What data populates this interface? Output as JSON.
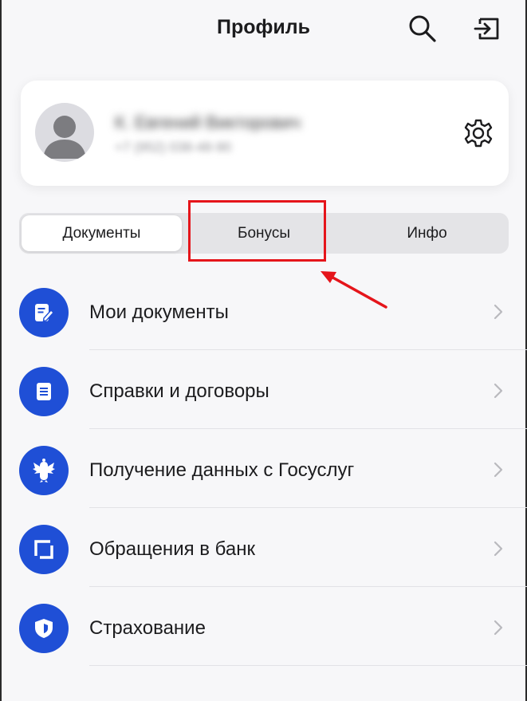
{
  "header": {
    "title": "Профиль",
    "search_icon": "search-icon",
    "logout_icon": "logout-icon"
  },
  "profile": {
    "name": "К. Евгений Викторович",
    "phone": "+7 (952) 038-48-90",
    "avatar_icon": "user-avatar-icon",
    "settings_icon": "gear-icon"
  },
  "tabs": [
    {
      "label": "Документы",
      "active": true
    },
    {
      "label": "Бонусы",
      "active": false,
      "highlighted": true
    },
    {
      "label": "Инфо",
      "active": false
    }
  ],
  "menu": {
    "items": [
      {
        "label": "Мои документы",
        "icon": "document-edit-icon"
      },
      {
        "label": "Справки и договоры",
        "icon": "document-list-icon"
      },
      {
        "label": "Получение данных с Госуслуг",
        "icon": "coat-of-arms-icon"
      },
      {
        "label": "Обращения в банк",
        "icon": "bracket-frame-icon"
      },
      {
        "label": "Страхование",
        "icon": "shield-icon"
      }
    ]
  },
  "colors": {
    "accent": "#1f4fd6",
    "highlight": "#e5151b",
    "background": "#f7f7f9"
  }
}
